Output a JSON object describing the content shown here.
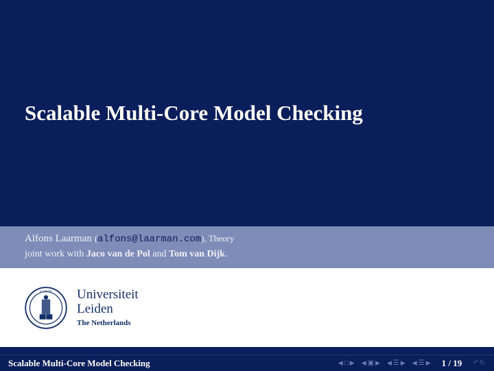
{
  "title": "Scalable Multi-Core Model Checking",
  "author": {
    "name": "Alfons Laarman",
    "email": "alfons@laarman.com",
    "dept": ", Theory",
    "joint_prefix": "joint work with ",
    "coauthor1": "Jaco van de Pol",
    "and": " and ",
    "coauthor2": "Tom van Dijk",
    "period": "."
  },
  "university": {
    "line1": "Universiteit",
    "line2": "Leiden",
    "country": "The Netherlands"
  },
  "footer": {
    "title": "Scalable Multi-Core Model Checking",
    "page_current": "1",
    "page_sep": " / ",
    "page_total": "19"
  }
}
